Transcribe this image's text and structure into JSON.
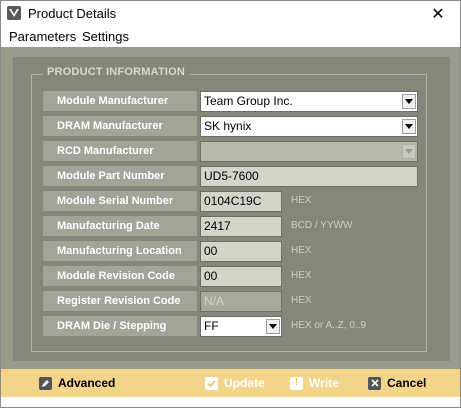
{
  "window": {
    "title": "Product Details",
    "close_glyph": "✕",
    "icon": "product-logo-icon"
  },
  "menu": {
    "items": [
      {
        "label": "Parameters"
      },
      {
        "label": "Settings"
      }
    ]
  },
  "section": {
    "title": "PRODUCT INFORMATION"
  },
  "rows": [
    {
      "label": "Module Manufacturer",
      "value": "Team Group Inc.",
      "unit": ""
    },
    {
      "label": "DRAM Manufacturer",
      "value": "SK hynix",
      "unit": ""
    },
    {
      "label": "RCD Manufacturer",
      "value": "",
      "unit": ""
    },
    {
      "label": "Module Part Number",
      "value": "UD5-7600",
      "unit": ""
    },
    {
      "label": "Module Serial Number",
      "value": "0104C19C",
      "unit": "HEX"
    },
    {
      "label": "Manufacturing Date",
      "value": "2417",
      "unit": "BCD / YYWW"
    },
    {
      "label": "Manufacturing Location",
      "value": "00",
      "unit": "HEX"
    },
    {
      "label": "Module Revision Code",
      "value": "00",
      "unit": "HEX"
    },
    {
      "label": "Register Revision Code",
      "value": "N/A",
      "unit": "HEX"
    },
    {
      "label": "DRAM Die / Stepping",
      "value": "FF",
      "unit": "HEX or A..Z, 0..9"
    }
  ],
  "footer": {
    "advanced": "Advanced",
    "update": "Update",
    "write": "Write",
    "cancel": "Cancel"
  },
  "colors": {
    "panel": "#9a9a8c",
    "footer": "#f3d58a",
    "label_bg": "#a3a397"
  }
}
